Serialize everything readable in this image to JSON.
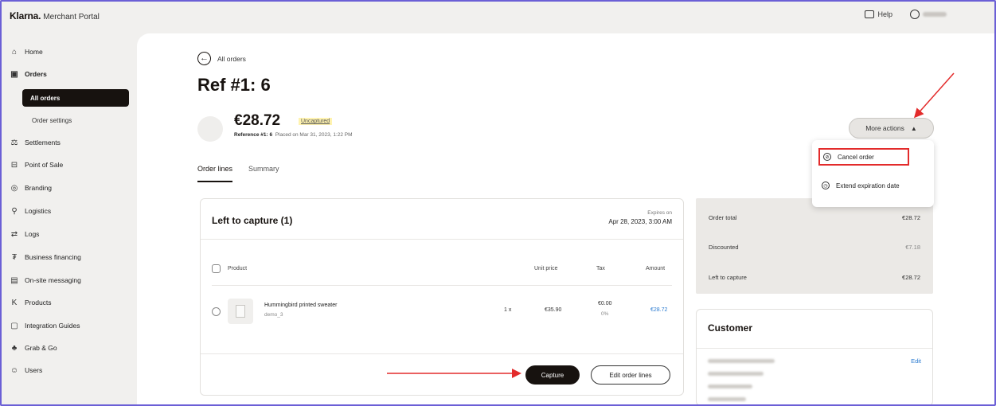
{
  "app": {
    "brand": "Klarna.",
    "portal": "Merchant Portal"
  },
  "topbar": {
    "help_label": "Help",
    "user_name": ""
  },
  "sidebar": {
    "items": [
      {
        "label": "Home",
        "icon": "home-icon"
      },
      {
        "label": "Orders",
        "icon": "orders-icon"
      },
      {
        "label": "Settlements",
        "icon": "settlements-icon"
      },
      {
        "label": "Point of Sale",
        "icon": "point-of-sale-icon"
      },
      {
        "label": "Branding",
        "icon": "branding-icon"
      },
      {
        "label": "Logistics",
        "icon": "logistics-icon"
      },
      {
        "label": "Logs",
        "icon": "logs-icon"
      },
      {
        "label": "Business financing",
        "icon": "business-financing-icon"
      },
      {
        "label": "On-site messaging",
        "icon": "on-site-messaging-icon"
      },
      {
        "label": "Products",
        "icon": "products-icon"
      },
      {
        "label": "Integration Guides",
        "icon": "integration-guides-icon"
      },
      {
        "label": "Grab & Go",
        "icon": "grab-and-go-icon"
      },
      {
        "label": "Users",
        "icon": "users-icon"
      }
    ],
    "orders_sub": [
      "All orders",
      "Order settings"
    ]
  },
  "main": {
    "back_label": "All orders",
    "title": "Ref #1: 6",
    "amount": "€28.72",
    "status_badge": "Uncaptured",
    "reference_bold": "Reference #1: 6",
    "placed_on": "Placed on Mar 31, 2023, 1:22 PM",
    "tabs": [
      "Order lines",
      "Summary"
    ],
    "more_actions": "More actions",
    "dropdown": [
      "Cancel order",
      "Extend expiration date"
    ]
  },
  "capture_card": {
    "title": "Left to capture (1)",
    "expires_label": "Expires on",
    "expires_value": "Apr 28, 2023, 3:00 AM",
    "columns": [
      "Product",
      "Unit price",
      "Tax",
      "Amount"
    ],
    "rows": [
      {
        "name": "Hummingbird printed sweater",
        "sku": "demo_3",
        "qty": "1 x",
        "unit_price": "€35.90",
        "tax": "€0.00",
        "tax_rate": "0%",
        "amount": "€28.72"
      }
    ],
    "capture_button": "Capture",
    "edit_button": "Edit order lines"
  },
  "summary": [
    {
      "label": "Order total",
      "value": "€28.72"
    },
    {
      "label": "Discounted",
      "value": "€7.18"
    },
    {
      "label": "Left to capture",
      "value": "€28.72"
    }
  ],
  "customer": {
    "title": "Customer",
    "edit_label": "Edit"
  },
  "colors": {
    "accent_dark": "#17120f",
    "link": "#2b7bd0",
    "highlight": "#e32b2b",
    "badge_bg": "#fff3b0"
  }
}
